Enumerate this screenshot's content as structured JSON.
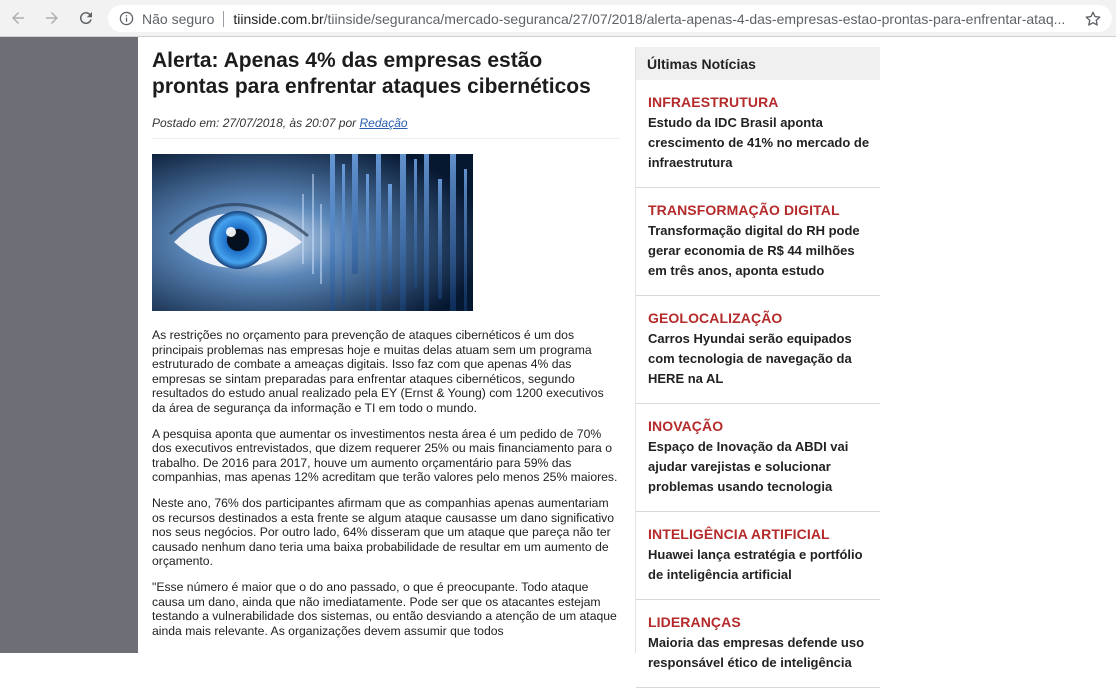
{
  "browser": {
    "secure_label": "Não seguro",
    "url_host": "tiinside.com.br",
    "url_path": "/tiinside/seguranca/mercado-seguranca/27/07/2018/alerta-apenas-4-das-empresas-estao-prontas-para-enfrentar-ataq..."
  },
  "article": {
    "title": "Alerta: Apenas 4% das empresas estão prontas para enfrentar ataques cibernéticos",
    "meta_prefix": "Postado em: 27/07/2018, às 20:07 por",
    "author": "Redação",
    "paragraphs": [
      "As restrições no orçamento para prevenção de ataques cibernéticos é um dos principais problemas nas empresas hoje e muitas delas atuam sem um programa estruturado de combate a ameaças digitais. Isso faz com que apenas 4% das empresas se sintam preparadas para enfrentar ataques cibernéticos, segundo resultados do estudo anual realizado pela EY (Ernst & Young) com 1200 executivos da área de segurança da informação e TI em todo o mundo.",
      "A pesquisa aponta que aumentar os investimentos nesta área é um pedido de 70% dos executivos entrevistados, que dizem requerer 25% ou mais financiamento para o trabalho. De 2016 para 2017, houve um aumento orçamentário para 59% das companhias, mas apenas 12% acreditam que terão valores pelo menos 25% maiores.",
      "Neste ano, 76% dos participantes afirmam que as companhias apenas aumentariam os recursos destinados a esta frente se algum ataque causasse um dano significativo nos seus negócios. Por outro lado, 64% disseram que um ataque que pareça não ter causado nenhum dano teria uma baixa probabilidade de resultar em um aumento de orçamento.",
      "\"Esse número é maior que o do ano passado, o que é preocupante. Todo ataque causa um dano, ainda que não imediatamente. Pode ser que os atacantes estejam testando a vulnerabilidade dos sistemas, ou então desviando a atenção de um ataque ainda mais relevante. As organizações devem assumir que todos"
    ]
  },
  "sidebar": {
    "header": "Últimas Notícias",
    "items": [
      {
        "category": "INFRAESTRUTURA",
        "title": "Estudo da IDC Brasil aponta crescimento de 41% no mercado de infraestrutura"
      },
      {
        "category": "TRANSFORMAÇÃO DIGITAL",
        "title": "Transformação digital do RH pode gerar economia de R$ 44 milhões em três anos, aponta estudo"
      },
      {
        "category": "GEOLOCALIZAÇÃO",
        "title": "Carros Hyundai serão equipados com tecnologia de navegação da HERE na AL"
      },
      {
        "category": "INOVAÇÃO",
        "title": "Espaço de Inovação da ABDI vai ajudar varejistas e solucionar problemas usando tecnologia"
      },
      {
        "category": "INTELIGÊNCIA ARTIFICIAL",
        "title": "Huawei lança estratégia e portfólio de inteligência artificial"
      },
      {
        "category": "LIDERANÇAS",
        "title": "Maioria das empresas defende uso responsável ético de inteligência"
      }
    ]
  },
  "icons": {
    "back": "arrow-left-icon",
    "forward": "arrow-right-icon",
    "reload": "reload-icon",
    "info": "info-icon",
    "star": "star-icon"
  }
}
